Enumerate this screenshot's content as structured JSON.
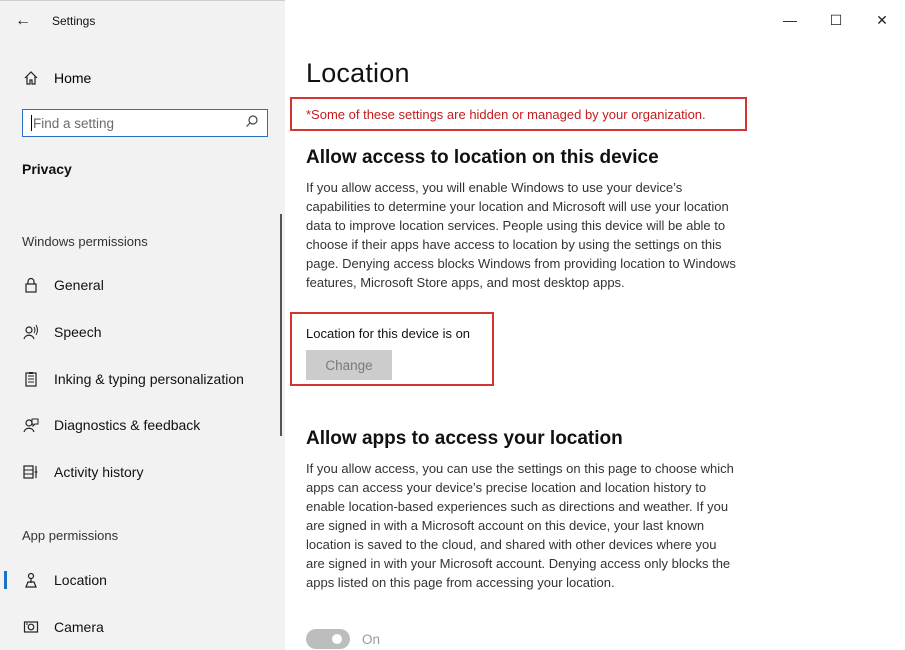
{
  "window": {
    "title": "Settings",
    "controls": {
      "minimize": "—",
      "maximize": "☐",
      "close": "✕"
    }
  },
  "sidebar": {
    "home_label": "Home",
    "search_placeholder": "Find a setting",
    "section_title": "Privacy",
    "windows_permissions_label": "Windows permissions",
    "windows_items": [
      {
        "label": "General",
        "icon": "lock-icon"
      },
      {
        "label": "Speech",
        "icon": "speech-icon"
      },
      {
        "label": "Inking & typing personalization",
        "icon": "inking-icon"
      },
      {
        "label": "Diagnostics & feedback",
        "icon": "feedback-icon"
      },
      {
        "label": "Activity history",
        "icon": "activity-icon"
      }
    ],
    "app_permissions_label": "App permissions",
    "app_items": [
      {
        "label": "Location",
        "icon": "location-icon",
        "active": true
      },
      {
        "label": "Camera",
        "icon": "camera-icon"
      }
    ]
  },
  "main": {
    "title": "Location",
    "warning": "*Some of these settings are hidden or managed by your organization.",
    "section1": {
      "heading": "Allow access to location on this device",
      "body": "If you allow access, you will enable Windows to use your device’s capabilities to determine your location and Microsoft will use your location data to improve location services. People using this device will be able to choose if their apps have access to location by using the settings on this page. Denying access blocks Windows from providing location to Windows features, Microsoft Store apps, and most desktop apps.",
      "status": "Location for this device is on",
      "change_button": "Change"
    },
    "section2": {
      "heading": "Allow apps to access your location",
      "body": "If you allow access, you can use the settings on this page to choose which apps can access your device’s precise location and location history to enable location-based experiences such as directions and weather. If you are signed in with a Microsoft account on this device, your last known location is saved to the cloud, and shared with other devices where you are signed in with your Microsoft account. Denying access only blocks the apps listed on this page from accessing your location.",
      "toggle_label": "On"
    }
  },
  "colors": {
    "accent": "#1a73c8",
    "warning_red": "#d63333",
    "sidebar_bg": "#f2f2f2"
  }
}
